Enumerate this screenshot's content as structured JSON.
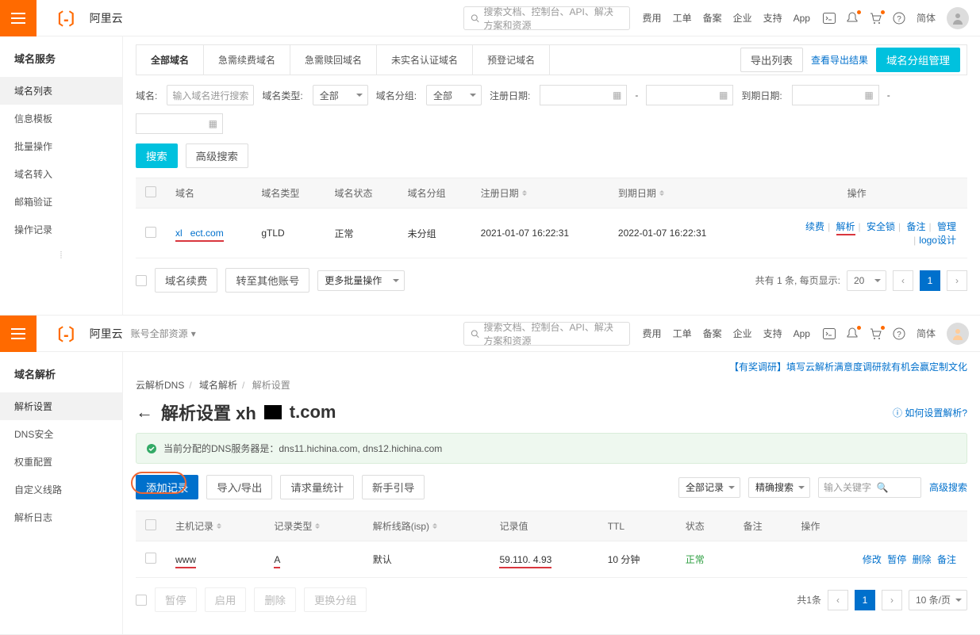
{
  "top": {
    "brand": "阿里云",
    "search_ph": "搜索文档、控制台、API、解决方案和资源",
    "nav": [
      "费用",
      "工单",
      "备案",
      "企业",
      "支持",
      "App"
    ],
    "lang": "简体",
    "account_scope": "账号全部资源"
  },
  "p1": {
    "sidebar_title": "域名服务",
    "sidebar": [
      "域名列表",
      "信息模板",
      "批量操作",
      "域名转入",
      "邮箱验证",
      "操作记录"
    ],
    "tabs": [
      "全部域名",
      "急需续费域名",
      "急需赎回域名",
      "未实名认证域名",
      "预登记域名"
    ],
    "btn_export": "导出列表",
    "link_results": "查看导出结果",
    "btn_group": "域名分组管理",
    "filters": {
      "name": "域名:",
      "name_ph": "输入域名进行搜索",
      "type": "域名类型:",
      "type_v": "全部",
      "group": "域名分组:",
      "group_v": "全部",
      "reg": "注册日期:",
      "exp": "到期日期:"
    },
    "search": "搜索",
    "adv": "高级搜索",
    "cols": {
      "name": "域名",
      "type": "域名类型",
      "status": "域名状态",
      "group": "域名分组",
      "reg": "注册日期",
      "exp": "到期日期",
      "ops": "操作"
    },
    "row": {
      "name_a": "xl",
      "name_b": "ect.com",
      "type": "gTLD",
      "status": "正常",
      "group": "未分组",
      "reg": "2021-01-07 16:22:31",
      "exp": "2022-01-07 16:22:31",
      "ops": {
        "renew": "续费",
        "resolve": "解析",
        "lock": "安全锁",
        "note": "备注",
        "manage": "管理",
        "logo": "logo设计"
      }
    },
    "bulk": {
      "renew": "域名续费",
      "transfer": "转至其他账号",
      "more": "更多批量操作"
    },
    "pager": {
      "total": "共有 1 条, 每页显示:",
      "size": "20"
    }
  },
  "p2": {
    "sidebar_title": "域名解析",
    "sidebar": [
      "解析设置",
      "DNS安全",
      "权重配置",
      "自定义线路",
      "解析日志"
    ],
    "crumbs": [
      "云解析DNS",
      "域名解析",
      "解析设置"
    ],
    "promo": "【有奖调研】填写云解析满意度调研就有机会赢定制文化",
    "title_pre": "解析设置 xh",
    "title_suf": "t.com",
    "help": "如何设置解析?",
    "dns_prefix": "当前分配的DNS服务器是：",
    "dns_list": "dns11.hichina.com, dns12.hichina.com",
    "actions": {
      "add": "添加记录",
      "import": "导入/导出",
      "stats": "请求量统计",
      "guide": "新手引导"
    },
    "search": {
      "scope": "全部记录",
      "mode": "精确搜索",
      "ph": "输入关键字",
      "adv": "高级搜索"
    },
    "cols": {
      "host": "主机记录",
      "type": "记录类型",
      "isp": "解析线路(isp)",
      "value": "记录值",
      "ttl": "TTL",
      "status": "状态",
      "note": "备注",
      "ops": "操作"
    },
    "row": {
      "host": "www",
      "type": "A",
      "isp": "默认",
      "value": "59.110.   4.93",
      "ttl": "10 分钟",
      "status": "正常",
      "ops": {
        "edit": "修改",
        "pause": "暂停",
        "del": "删除",
        "note": "备注"
      }
    },
    "bulk": {
      "pause": "暂停",
      "enable": "启用",
      "del": "删除",
      "change": "更换分组"
    },
    "pager": {
      "total": "共1条",
      "size": "10 条/页"
    }
  }
}
